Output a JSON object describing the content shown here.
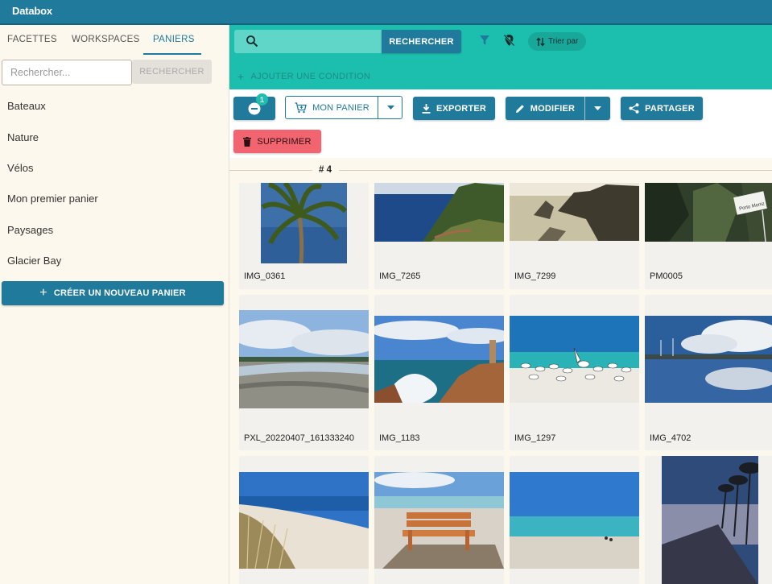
{
  "app": {
    "title": "Databox"
  },
  "sidebar": {
    "tabs": [
      "FACETTES",
      "WORKSPACES",
      "PANIERS"
    ],
    "active_tab": "PANIERS",
    "search": {
      "placeholder": "Rechercher...",
      "button_label": "RECHERCHER"
    },
    "baskets": [
      "Bateaux",
      "Nature",
      "Vélos",
      "Mon premier panier",
      "Paysages",
      "Glacier Bay"
    ],
    "create_button_label": "CRÉER UN NOUVEAU PANIER"
  },
  "searchbar": {
    "button_label": "RECHERCHER",
    "sort_label": "Trier par",
    "add_condition_label": "AJOUTER UNE CONDITION"
  },
  "toolbar": {
    "selection_count": "1",
    "basket_label": "MON PANIER",
    "export_label": "EXPORTER",
    "edit_label": "MODIFIER",
    "share_label": "PARTAGER",
    "delete_label": "SUPPRIMER"
  },
  "results": {
    "group_label": "# 4",
    "items": [
      {
        "name": "IMG_0361"
      },
      {
        "name": "IMG_7265"
      },
      {
        "name": "IMG_7299"
      },
      {
        "name": "PM0005"
      },
      {
        "name": "PXL_20220407_161333240"
      },
      {
        "name": "IMG_1183"
      },
      {
        "name": "IMG_1297"
      },
      {
        "name": "IMG_4702"
      },
      {
        "name": ""
      },
      {
        "name": ""
      },
      {
        "name": ""
      },
      {
        "name": ""
      }
    ]
  },
  "colors": {
    "primary": "#1f7a9c",
    "accent": "#1cbfad",
    "danger": "#f26570",
    "panel": "#fdf8ed"
  }
}
